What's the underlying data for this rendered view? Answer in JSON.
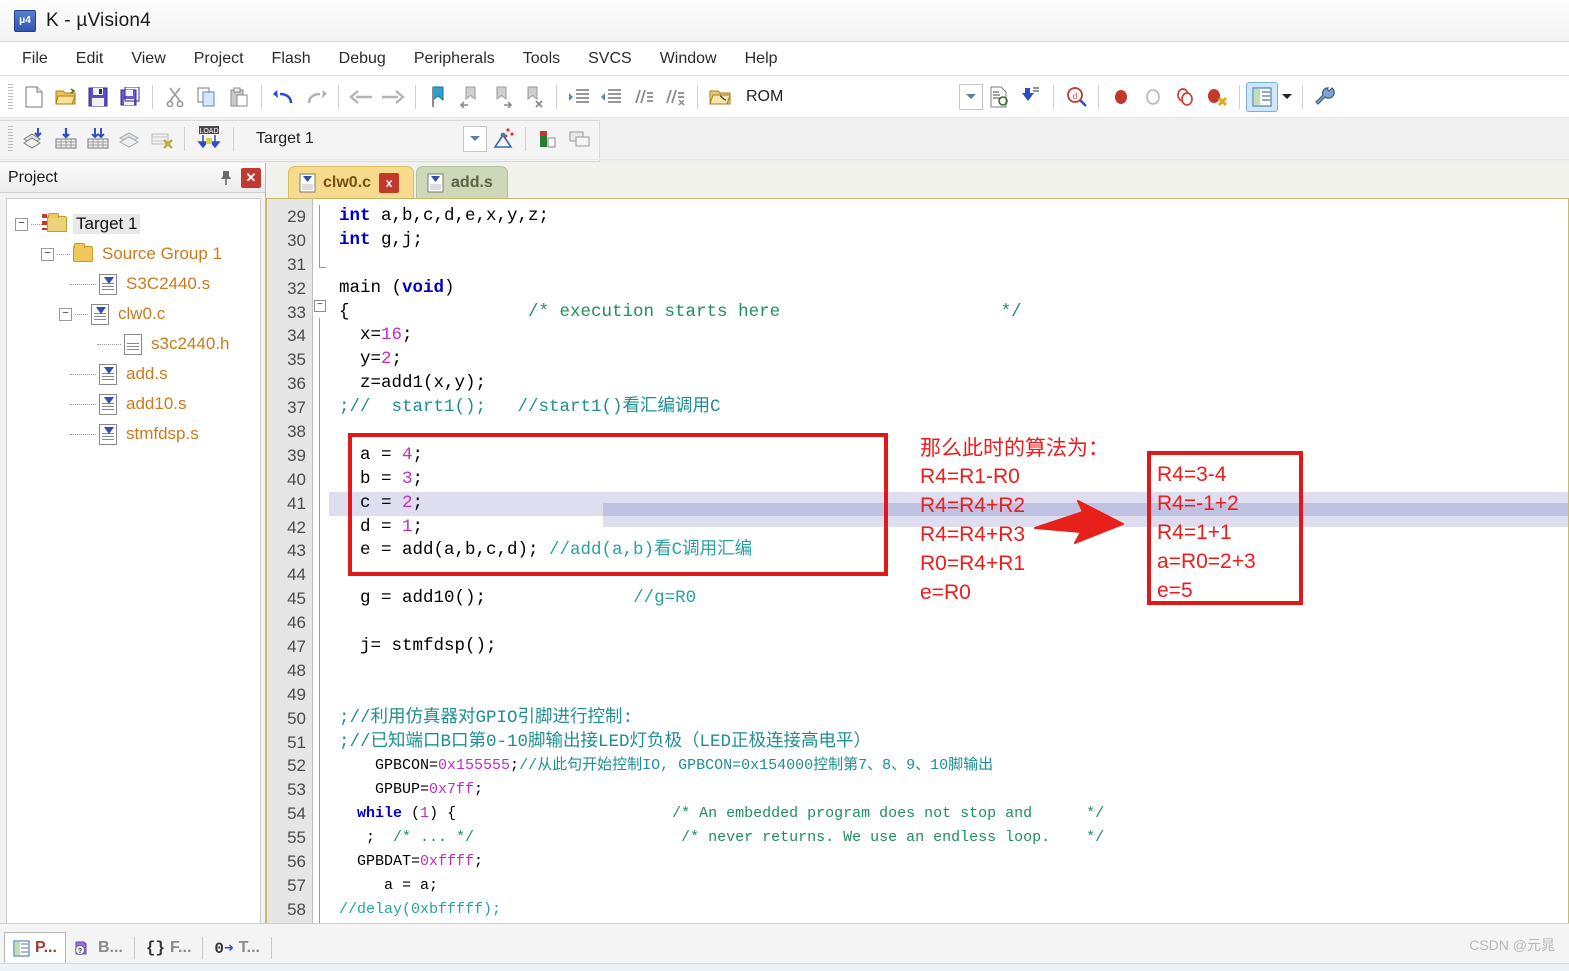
{
  "window": {
    "title": "K  - µVision4",
    "app_icon": "keil-uvision-icon"
  },
  "menu": {
    "items": [
      {
        "label": "File"
      },
      {
        "label": "Edit"
      },
      {
        "label": "View"
      },
      {
        "label": "Project"
      },
      {
        "label": "Flash"
      },
      {
        "label": "Debug"
      },
      {
        "label": "Peripherals"
      },
      {
        "label": "Tools"
      },
      {
        "label": "SVCS"
      },
      {
        "label": "Window"
      },
      {
        "label": "Help"
      }
    ]
  },
  "toolbar1": {
    "buttons": [
      {
        "name": "new-file-icon",
        "title": "New"
      },
      {
        "name": "open-file-icon",
        "title": "Open"
      },
      {
        "name": "save-icon",
        "title": "Save"
      },
      {
        "name": "save-all-icon",
        "title": "Save All"
      },
      {
        "name": "cut-icon",
        "title": "Cut"
      },
      {
        "name": "copy-icon",
        "title": "Copy"
      },
      {
        "name": "paste-icon",
        "title": "Paste"
      },
      {
        "name": "undo-icon",
        "title": "Undo"
      },
      {
        "name": "redo-icon",
        "title": "Redo"
      },
      {
        "name": "navigate-back-icon",
        "title": "Back"
      },
      {
        "name": "navigate-forward-icon",
        "title": "Forward"
      },
      {
        "name": "bookmark-toggle-icon",
        "title": "Insert/Remove Bookmark"
      },
      {
        "name": "bookmark-prev-icon",
        "title": "Previous Bookmark"
      },
      {
        "name": "bookmark-next-icon",
        "title": "Next Bookmark"
      },
      {
        "name": "bookmark-clear-icon",
        "title": "Clear All Bookmarks"
      },
      {
        "name": "indent-icon",
        "title": "Indent"
      },
      {
        "name": "outdent-icon",
        "title": "Outdent"
      },
      {
        "name": "comment-icon",
        "title": "Comment"
      },
      {
        "name": "uncomment-icon",
        "title": "Uncomment"
      },
      {
        "name": "open-project-icon",
        "title": "Open Project"
      }
    ],
    "rom_label": "ROM",
    "right_buttons": [
      {
        "name": "combo-dropdown-icon",
        "title": "Select"
      },
      {
        "name": "file-find-icon",
        "title": "Find in Files"
      },
      {
        "name": "goto-icon",
        "title": "Go To"
      },
      {
        "name": "magnify-debug-icon",
        "title": "Start/Stop Debug Session"
      },
      {
        "name": "breakpoint-insert-icon",
        "title": "Insert/Remove Breakpoint"
      },
      {
        "name": "breakpoint-disable-icon",
        "title": "Enable/Disable Breakpoint"
      },
      {
        "name": "breakpoint-disable-all-icon",
        "title": "Disable All Breakpoints"
      },
      {
        "name": "breakpoint-kill-all-icon",
        "title": "Kill All Breakpoints"
      },
      {
        "name": "window-layout-icon",
        "title": "Manage Windows"
      },
      {
        "name": "dropdown-arrow-icon",
        "title": "More"
      },
      {
        "name": "configure-icon",
        "title": "Configuration Wizard"
      }
    ]
  },
  "toolbar2": {
    "buttons": [
      {
        "name": "translate-icon",
        "title": "Translate"
      },
      {
        "name": "build-icon",
        "title": "Build"
      },
      {
        "name": "rebuild-icon",
        "title": "Rebuild"
      },
      {
        "name": "batch-build-icon",
        "title": "Batch Build"
      },
      {
        "name": "stop-build-icon",
        "title": "Stop Build"
      },
      {
        "name": "download-icon",
        "title": "Download (LOAD)"
      }
    ],
    "target_value": "Target 1",
    "target_dropdown": "chevron-down-icon",
    "right_buttons": [
      {
        "name": "target-options-icon",
        "title": "Target Options"
      },
      {
        "name": "manage-components-icon",
        "title": "Manage Components"
      },
      {
        "name": "multi-project-icon",
        "title": "Multi-Project"
      }
    ]
  },
  "project_panel": {
    "title": "Project",
    "pin_icon": "pin-icon",
    "close_icon": "close-icon",
    "tree": [
      {
        "label": "Target 1",
        "depth": 0,
        "kind": "target",
        "expander": "minus"
      },
      {
        "label": "Source Group 1",
        "depth": 1,
        "kind": "folder",
        "expander": "minus"
      },
      {
        "label": "S3C2440.s",
        "depth": 2,
        "kind": "asm",
        "expander": "none"
      },
      {
        "label": "clw0.c",
        "depth": 2,
        "kind": "asm",
        "expander": "minus"
      },
      {
        "label": "s3c2440.h",
        "depth": 3,
        "kind": "header",
        "expander": "none"
      },
      {
        "label": "add.s",
        "depth": 2,
        "kind": "asm",
        "expander": "none"
      },
      {
        "label": "add10.s",
        "depth": 2,
        "kind": "asm",
        "expander": "none"
      },
      {
        "label": "stmfdsp.s",
        "depth": 2,
        "kind": "asm",
        "expander": "none"
      }
    ]
  },
  "editor": {
    "tabs": [
      {
        "label": "clw0.c",
        "active": true,
        "closable": true
      },
      {
        "label": "add.s",
        "active": false,
        "closable": false
      }
    ],
    "first_line": 29,
    "highlight_line": 41,
    "lines": [
      {
        "n": 29,
        "text": "int a,b,c,d,e,x,y,z;"
      },
      {
        "n": 30,
        "text": "int g,j;"
      },
      {
        "n": 31,
        "text": ""
      },
      {
        "n": 32,
        "text": "main (void)"
      },
      {
        "n": 33,
        "text": "{                 /* execution starts here                     */"
      },
      {
        "n": 34,
        "text": "  x=16;"
      },
      {
        "n": 35,
        "text": "  y=2;"
      },
      {
        "n": 36,
        "text": "  z=add1(x,y);"
      },
      {
        "n": 37,
        "text": ";//  start1();   //start1()看汇编调用C"
      },
      {
        "n": 38,
        "text": ""
      },
      {
        "n": 39,
        "text": "  a = 4;"
      },
      {
        "n": 40,
        "text": "  b = 3;"
      },
      {
        "n": 41,
        "text": "  c = 2;"
      },
      {
        "n": 42,
        "text": "  d = 1;"
      },
      {
        "n": 43,
        "text": "  e = add(a,b,c,d); //add(a,b)看C调用汇编"
      },
      {
        "n": 44,
        "text": ""
      },
      {
        "n": 45,
        "text": "  g = add10();              //g=R0"
      },
      {
        "n": 46,
        "text": ""
      },
      {
        "n": 47,
        "text": "  j= stmfdsp();"
      },
      {
        "n": 48,
        "text": ""
      },
      {
        "n": 49,
        "text": ""
      },
      {
        "n": 50,
        "text": ";//利用仿真器对GPIO引脚进行控制:"
      },
      {
        "n": 51,
        "text": ";//已知端口B口第0-10脚输出接LED灯负极（LED正极连接高电平）"
      },
      {
        "n": 52,
        "text": "    GPBCON=0x155555;//从此句开始控制IO, GPBCON=0x154000控制第7、8、9、10脚输出"
      },
      {
        "n": 53,
        "text": "    GPBUP=0x7ff;"
      },
      {
        "n": 54,
        "text": "  while (1) {                        /* An embedded program does not stop and      */"
      },
      {
        "n": 55,
        "text": "   ;  /* ... */                       /* never returns. We use an endless loop.    */"
      },
      {
        "n": 56,
        "text": "  GPBDAT=0xffff;"
      },
      {
        "n": 57,
        "text": "     a = a;"
      },
      {
        "n": 58,
        "text": "//delay(0xbfffff);"
      }
    ]
  },
  "annotations": {
    "red_color": "#ee1c1c",
    "box_color": "#e01818",
    "heading": "那么此时的算法为：",
    "left_lines": [
      "R4=R1-R0",
      "R4=R4+R2",
      "R4=R4+R3",
      "R0=R4+R1",
      "e=R0"
    ],
    "arrow_icon": "right-arrow-annotation-icon",
    "right_lines": [
      "R4=3-4",
      "R4=-1+2",
      "R4=1+1",
      "a=R0=2+3",
      "e=5"
    ]
  },
  "bottom": {
    "tabs": [
      {
        "label": "P...",
        "icon": "project-icon",
        "active": true
      },
      {
        "label": "B...",
        "icon": "books-icon",
        "active": false
      },
      {
        "label": "F...",
        "icon": "functions-icon",
        "active": false
      },
      {
        "label": "T...",
        "icon": "templates-icon",
        "active": false
      }
    ],
    "scroll_left_icon": "scroll-left-arrow-icon",
    "watermark": "CSDN @元晁"
  }
}
